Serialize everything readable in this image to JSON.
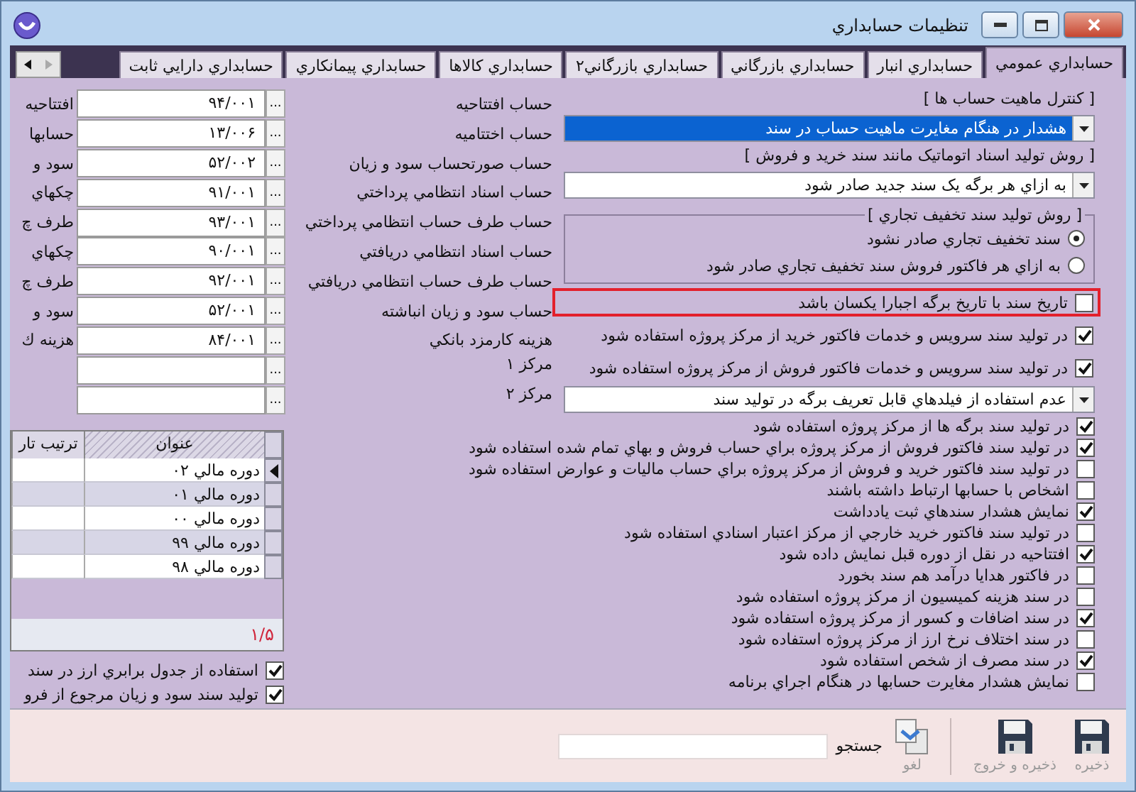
{
  "window": {
    "title": "تنظيمات حسابداري"
  },
  "tabs": [
    {
      "label": "حسابداري عمومي",
      "selected": true
    },
    {
      "label": "حسابداري انبار",
      "selected": false
    },
    {
      "label": "حسابداري بازرگاني",
      "selected": false
    },
    {
      "label": "حسابداري بازرگاني۲",
      "selected": false
    },
    {
      "label": "حسابداري كالاها",
      "selected": false
    },
    {
      "label": "حسابداري پيمانكاري",
      "selected": false
    },
    {
      "label": "حسابداري دارايي ثابت",
      "selected": false
    }
  ],
  "settings": [
    {
      "kind": "heading",
      "text": "[ كنترل ماهيت حساب ها ]"
    },
    {
      "kind": "dropdown",
      "value": "هشدار در هنگام مغايرت ماهيت حساب در سند",
      "focused": true
    },
    {
      "kind": "heading",
      "text": "[ روش توليد اسناد اتوماتيک مانند سند خريد و فروش ]"
    },
    {
      "kind": "dropdown",
      "value": "به ازاي هر برگه يک سند جديد صادر شود",
      "focused": false
    },
    {
      "kind": "radio_group",
      "title": "[ روش توليد سند تخفيف تجاري ]",
      "options": [
        {
          "label": "سند تخفيف تجاري صادر نشود",
          "selected": true
        },
        {
          "label": "به ازاي هر فاكتور فروش سند تخفيف تجاري صادر شود",
          "selected": false
        }
      ]
    },
    {
      "kind": "checkbox",
      "label": "تاريخ سند با تاريخ برگه اجبارا يكسان باشد",
      "checked": false,
      "highlighted": true
    },
    {
      "kind": "checkbox",
      "label": "در توليد سند سرويس و خدمات فاكتور خريد از مركز پروژه استفاده شود",
      "checked": true,
      "highlighted": false
    },
    {
      "kind": "checkbox",
      "label": "در توليد سند سرويس و خدمات فاكتور فروش از مركز پروژه استفاده شود",
      "checked": true,
      "highlighted": false
    },
    {
      "kind": "dropdown",
      "value": "عدم استفاده از فيلدهاي قابل تعريف برگه در توليد سند",
      "focused": false
    }
  ],
  "accounts": [
    {
      "label": "حساب افتتاحيه",
      "value": "۹۴/۰۰۱",
      "picker": "...",
      "edge_label": "افتتاحيه"
    },
    {
      "label": "حساب اختتاميه",
      "value": "۱۳/۰۰۶",
      "picker": "...",
      "edge_label": "حسابها"
    },
    {
      "label": "حساب صورتحساب سود و زيان",
      "value": "۵۲/۰۰۲",
      "picker": "...",
      "edge_label": "سود و"
    },
    {
      "label": "حساب اسناد انتظامي پرداختي",
      "value": "۹۱/۰۰۱",
      "picker": "...",
      "edge_label": "چكهاي"
    },
    {
      "label": "حساب طرف حساب انتظامي پرداختي",
      "value": "۹۳/۰۰۱",
      "picker": "...",
      "edge_label": "طرف چ"
    },
    {
      "label": "حساب اسناد انتظامي دريافتي",
      "value": "۹۰/۰۰۱",
      "picker": "...",
      "edge_label": "چكهاي"
    },
    {
      "label": "حساب طرف حساب انتظامي دريافتي",
      "value": "۹۲/۰۰۱",
      "picker": "...",
      "edge_label": "طرف چ"
    },
    {
      "label": "حساب سود و زيان انباشته",
      "value": "۵۲/۰۰۱",
      "picker": "...",
      "edge_label": "سود و"
    },
    {
      "label": "هزينه كارمزد بانكي",
      "value": "۸۴/۰۰۱",
      "picker": "...",
      "edge_label": "هزينه ك"
    },
    {
      "label": "مركز ۱",
      "picker": "..."
    },
    {
      "label": "مركز ۲",
      "picker": "..."
    }
  ],
  "options": [
    {
      "label": "در توليد سند برگه ها از مركز پروژه استفاده شود",
      "checked": true
    },
    {
      "label": "در توليد سند فاكتور فروش از مركز پروژه براي حساب فروش و بهاي تمام شده استفاده شود",
      "checked": true
    },
    {
      "label": "در توليد سند فاكتور خريد و فروش از مركز پروژه براي حساب ماليات و عوارض استفاده شود",
      "checked": false
    },
    {
      "label": "اشخاص با حسابها ارتباط داشته باشند",
      "checked": false
    },
    {
      "label": "نمايش هشدار سندهاي ثبت يادداشت",
      "checked": true
    },
    {
      "label": "در توليد سند فاكتور خريد خارجي از مركز اعتبار اسنادي استفاده شود",
      "checked": false
    },
    {
      "label": "افتتاحيه در نقل از دوره قبل نمايش داده شود",
      "checked": true
    },
    {
      "label": "در فاكتور هدايا درآمد هم سند بخورد",
      "checked": false
    },
    {
      "label": "در سند هزينه كميسيون از مركز پروژه استفاده شود",
      "checked": false
    },
    {
      "label": "در سند اضافات و كسور از مركز پروژه استفاده شود",
      "checked": true
    },
    {
      "label": "در سند اختلاف نرخ ارز از مركز پروژه استفاده شود",
      "checked": false
    },
    {
      "label": "در سند مصرف از شخص استفاده شود",
      "checked": true
    },
    {
      "label": "نمايش هشدار مغايرت حسابها در هنگام اجراي برنامه",
      "checked": false
    }
  ],
  "periods_grid": {
    "columns": [
      "عنوان",
      "ترتيب تار"
    ],
    "rows": [
      {
        "title": "دوره مالي ۰۲",
        "selected": true
      },
      {
        "title": "دوره مالي ۰۱",
        "selected": false
      },
      {
        "title": "دوره مالي ۰۰",
        "selected": false
      },
      {
        "title": "دوره مالي ۹۹",
        "selected": false
      },
      {
        "title": "دوره مالي ۹۸",
        "selected": false
      }
    ],
    "footer": "۱/۵"
  },
  "left_checkboxes": [
    {
      "label": "استفاده از جدول برابري ارز در سند",
      "checked": true
    },
    {
      "label": "توليد سند سود و زيان مرجوع از فرو",
      "checked": true
    }
  ],
  "toolbar": {
    "buttons": [
      {
        "kind": "save",
        "label": "ذخيره"
      },
      {
        "kind": "save",
        "label": "ذخيره و خروج"
      },
      {
        "kind": "cancel",
        "label": "لغو"
      }
    ],
    "search_label": "جستجو"
  }
}
